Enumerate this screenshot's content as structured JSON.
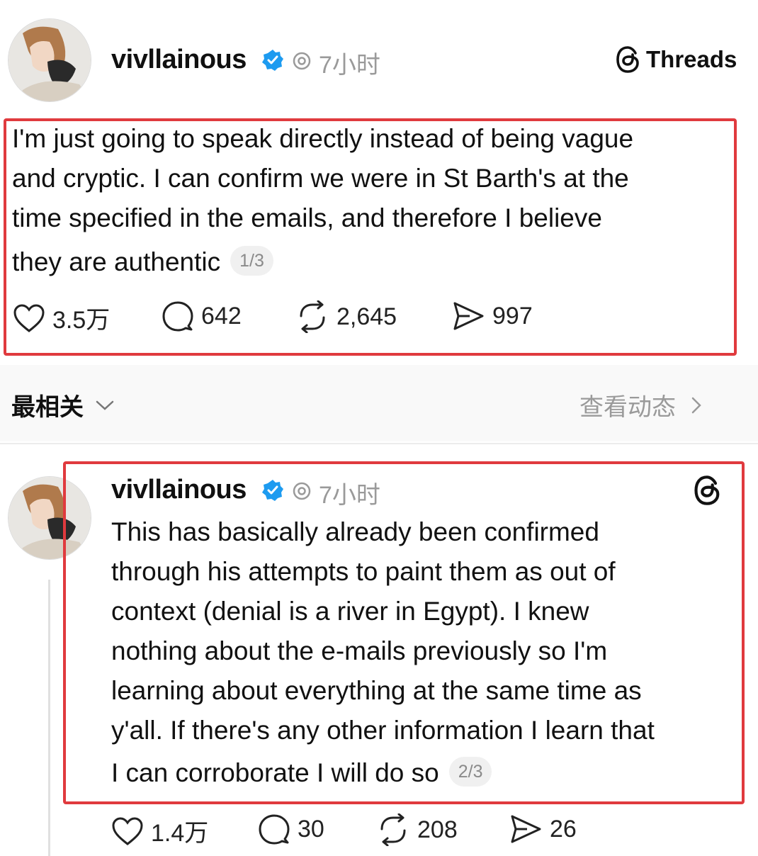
{
  "post1": {
    "username": "vivllainous",
    "time": "7小时",
    "platform_label": "Threads",
    "text_lines": [
      "I'm just going to speak directly instead of being vague",
      "and cryptic. I can confirm we were in St Barth's at the",
      "time specified in the emails, and therefore I believe",
      "they are authentic"
    ],
    "page_indicator": "1/3",
    "likes": "3.5万",
    "replies": "642",
    "reposts": "2,645",
    "shares": "997"
  },
  "sort": {
    "label": "最相关",
    "activity_link": "查看动态"
  },
  "post2": {
    "username": "vivllainous",
    "time": "7小时",
    "text_lines": [
      "This has basically already been confirmed",
      "through his attempts to paint them as out of",
      "context (denial is a river in Egypt). I knew",
      "nothing about the e-mails previously so I'm",
      "learning about everything at the same time as",
      "y'all. If there's any other information I learn that",
      "I can corroborate I will do so"
    ],
    "page_indicator": "2/3",
    "likes": "1.4万",
    "replies": "30",
    "reposts": "208",
    "shares": "26"
  },
  "colors": {
    "highlight_box": "#e03a3e",
    "verified_badge": "#1d9bf0"
  },
  "icons": [
    "verified-badge-icon",
    "threads-logo-icon",
    "heart-icon",
    "reply-icon",
    "repost-icon",
    "share-icon",
    "chevron-down-icon",
    "chevron-right-icon"
  ]
}
